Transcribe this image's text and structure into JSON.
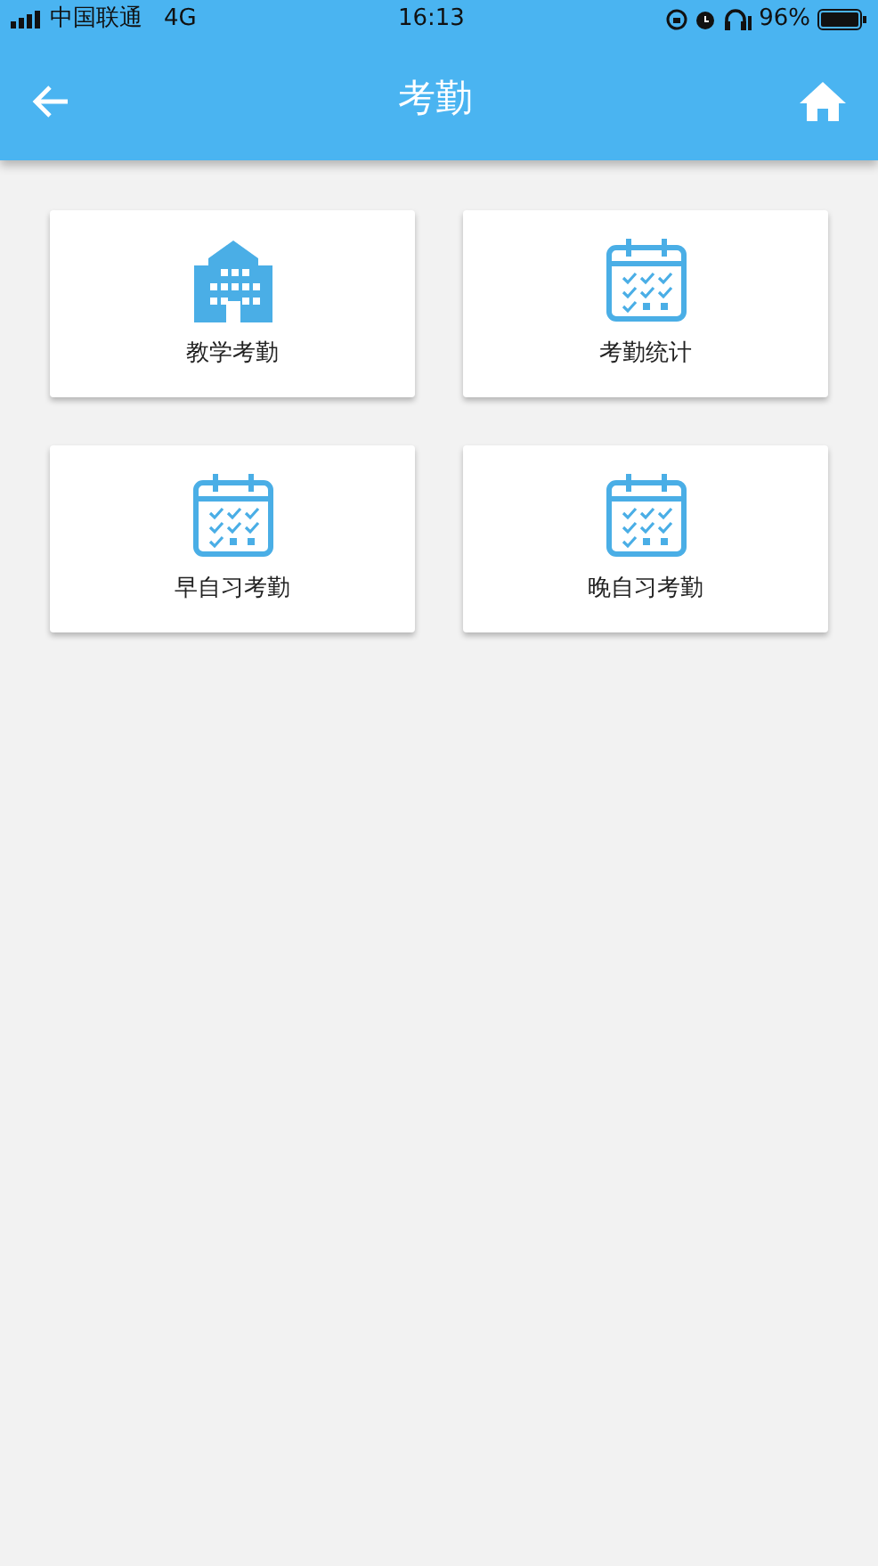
{
  "status_bar": {
    "carrier": "中国联通",
    "network": "4G",
    "time": "16:13",
    "battery": "96%"
  },
  "header": {
    "title": "考勤"
  },
  "tiles": [
    {
      "kind": "building",
      "label": "教学考勤"
    },
    {
      "kind": "calendar",
      "label": "考勤统计"
    },
    {
      "kind": "calendar",
      "label": "早自习考勤"
    },
    {
      "kind": "calendar",
      "label": "晚自习考勤"
    }
  ]
}
